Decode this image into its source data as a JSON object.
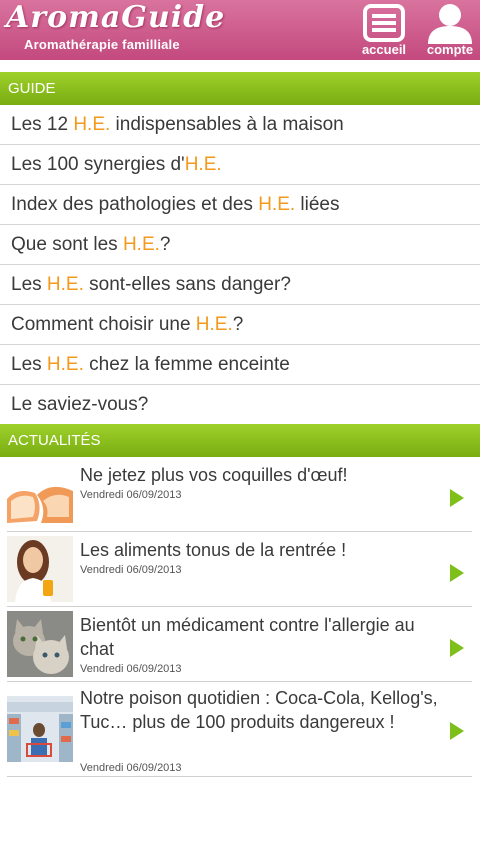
{
  "header": {
    "logo_text": "AromaGuide",
    "subtitle": "Aromathérapie familliale",
    "accueil_label": "accueil",
    "compte_label": "compte",
    "brand_color": "#c9548a"
  },
  "guide": {
    "section_title": "GUIDE",
    "items": [
      {
        "before": "Les 12 ",
        "he": "H.E.",
        "after": " indispensables à la maison"
      },
      {
        "before": "Les 100 synergies d'",
        "he": "H.E.",
        "after": ""
      },
      {
        "before": "Index des pathologies et des ",
        "he": "H.E.",
        "after": " liées"
      },
      {
        "before": "Que sont les ",
        "he": "H.E.",
        "after": "?"
      },
      {
        "before": "Les ",
        "he": "H.E.",
        "after": " sont-elles sans danger?"
      },
      {
        "before": "Comment choisir une ",
        "he": "H.E.",
        "after": "?"
      },
      {
        "before": "Les ",
        "he": "H.E.",
        "after": " chez la femme enceinte"
      },
      {
        "before": "Le saviez-vous?",
        "he": "",
        "after": ""
      }
    ]
  },
  "news": {
    "section_title": "ACTUALITÉS",
    "items": [
      {
        "title": "Ne jetez plus vos coquilles d'œuf!",
        "date": "Vendredi 06/09/2013",
        "thumb": "eggshell-thumbnail"
      },
      {
        "title": "Les aliments tonus de la rentrée !",
        "date": "Vendredi 06/09/2013",
        "thumb": "woman-juice-thumbnail"
      },
      {
        "title": "Bientôt un médicament contre l'allergie au chat",
        "date": "Vendredi 06/09/2013",
        "thumb": "cats-thumbnail"
      },
      {
        "title": "Notre poison quotidien : Coca-Cola, Kellog's, Tuc… plus de 100 produits dangereux !",
        "date": "Vendredi 06/09/2013",
        "thumb": "supermarket-thumbnail"
      }
    ]
  },
  "colors": {
    "accent_green": "#8cc21f",
    "highlight_orange": "#f39a1d",
    "arrow_green": "#7fbf1a"
  }
}
